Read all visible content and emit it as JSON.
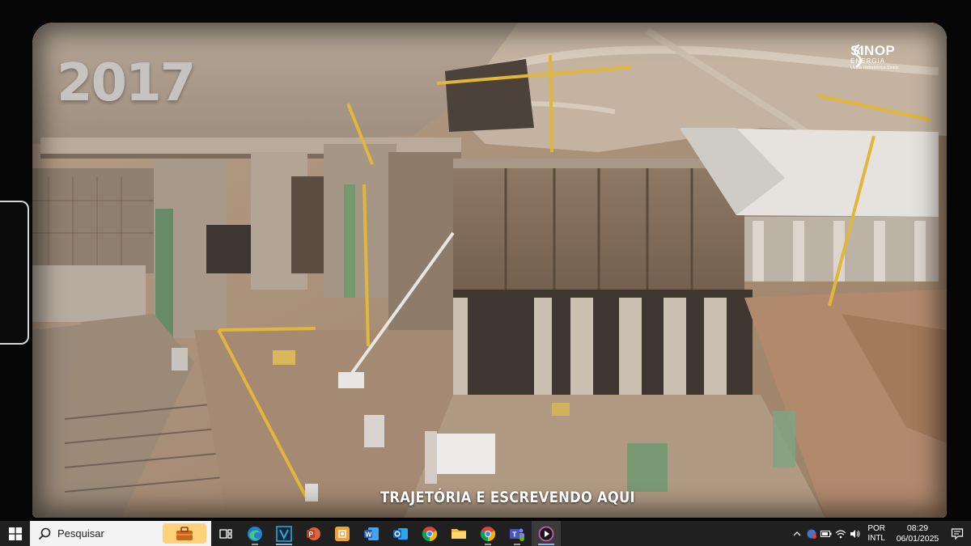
{
  "video": {
    "year_overlay": "2017",
    "subtitle": "TRAJETÓRIA E ESCREVENDO AQUI",
    "logo": {
      "name": "SINOP",
      "sub": "ENERGIA",
      "tagline": "Usina Hidrelétrica Sinop"
    }
  },
  "taskbar": {
    "search_placeholder": "Pesquisar",
    "apps": [
      {
        "name": "task-view",
        "icon": "task-view-icon"
      },
      {
        "name": "edge",
        "icon": "edge-icon"
      },
      {
        "name": "v-app",
        "icon": "v-app-icon"
      },
      {
        "name": "powerpoint",
        "icon": "powerpoint-icon"
      },
      {
        "name": "canva",
        "icon": "canva-icon"
      },
      {
        "name": "word",
        "icon": "word-icon"
      },
      {
        "name": "outlook",
        "icon": "outlook-icon"
      },
      {
        "name": "chrome",
        "icon": "chrome-icon"
      },
      {
        "name": "file-explorer",
        "icon": "folder-icon"
      },
      {
        "name": "chrome-2",
        "icon": "chrome-icon"
      },
      {
        "name": "teams",
        "icon": "teams-icon"
      },
      {
        "name": "media-player",
        "icon": "media-player-icon"
      }
    ],
    "tray": {
      "language_line1": "POR",
      "language_line2": "INTL",
      "time": "08:29",
      "date": "06/01/2025"
    }
  },
  "colors": {
    "taskbar_bg": "#202020",
    "search_bg": "#f3f3f3",
    "subtitle": "#ffffff"
  }
}
